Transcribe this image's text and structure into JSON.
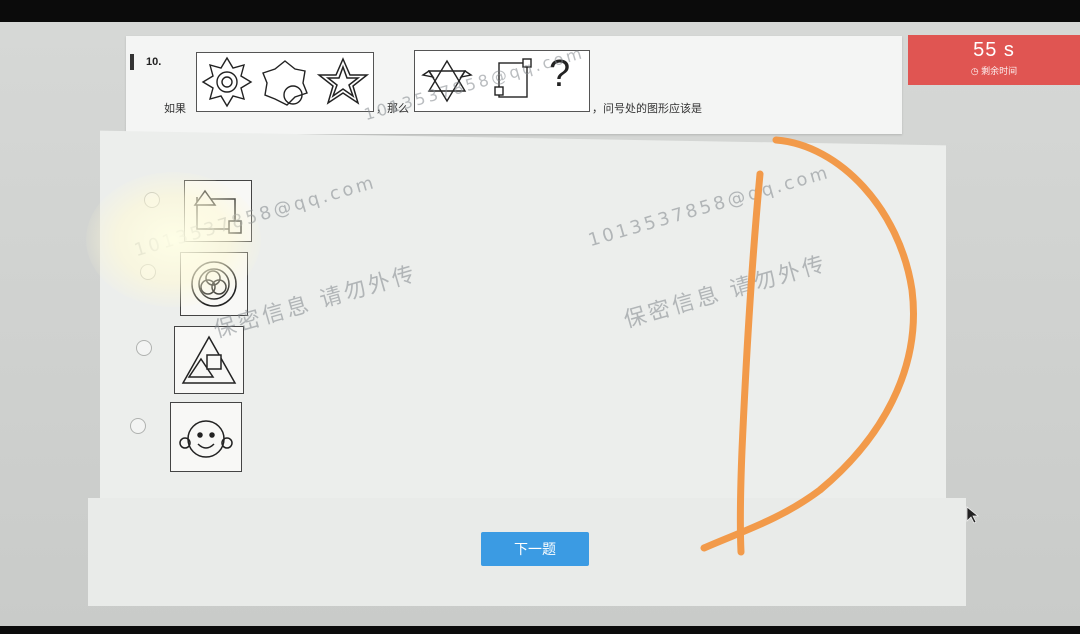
{
  "question": {
    "number": "10.",
    "if_label": "如果",
    "then_label": "，那么",
    "ask_label": "，问号处的图形应该是",
    "question_mark": "?"
  },
  "timer": {
    "value": "55 s",
    "label": "剩余时间"
  },
  "options": [
    {
      "icon": "square-triangle-arrow-icon"
    },
    {
      "icon": "nested-circles-icon"
    },
    {
      "icon": "triangle-square-icon"
    },
    {
      "icon": "smiley-face-icon"
    }
  ],
  "watermarks": [
    "1013537858@qq.com",
    "保密信息   请勿外传"
  ],
  "next_button": "下一题",
  "annotation": {
    "color": "#f29a4a",
    "letter": "D"
  },
  "colors": {
    "timer_bg": "#e05552",
    "button_bg": "#3b9be3"
  }
}
